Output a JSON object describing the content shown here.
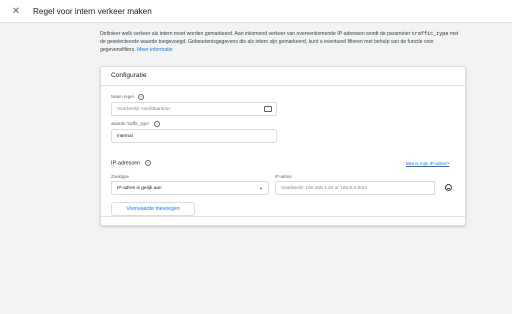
{
  "header": {
    "close_icon": "close-icon",
    "title": "Regel voor intern verkeer maken"
  },
  "intro": {
    "text_part1": "Definieer welk verkeer als intern moet worden gemarkeerd. Aan inkomend verkeer van overeenkomende IP-adressen wordt de parameter",
    "code": "traffic_type",
    "text_part2": "met de geselecteerde waarde toegevoegd. Gebeurtenisgegevens die als intern zijn gemarkeerd, kunt u eventueel filteren met behulp van de functie voor gegevensfilters.",
    "link": "Meer informatie"
  },
  "config": {
    "title": "Configuratie",
    "rule_name_label": "Naam regel",
    "rule_name_placeholder": "Voorbeeld: Hoofdkantoor",
    "traffic_type_label": "waarde 'traffic_type'",
    "traffic_type_value": "internal",
    "ip_section_title": "IP-adressen",
    "ip_help_link": "Wat is mijn IP-adres?",
    "match_type_label": "Zoektype",
    "match_type_value": "IP-adres is gelijk aan",
    "ip_label": "IP-adres",
    "ip_placeholder": "Voorbeeld: 192.168.1.20 or 192.0.2.0/24",
    "add_condition_label": "Voorwaarde toevoegen"
  }
}
